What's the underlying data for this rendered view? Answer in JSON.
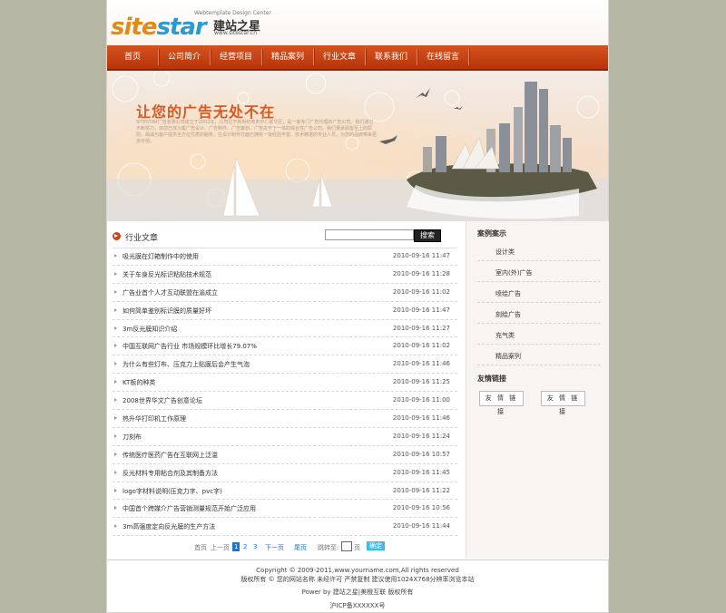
{
  "logo": {
    "tagline": "Webtemplate Design Center",
    "word_a": "site",
    "word_b": "star",
    "cn": "建站之星",
    "url": "www.sitestar.cn"
  },
  "nav": [
    "首页",
    "公司简介",
    "经营项目",
    "精品案列",
    "行业文章",
    "联系我们",
    "在线留言"
  ],
  "banner": {
    "title": "让您的广告无处不在",
    "text": "SITESTAR广告有限公司成立于2002年，公司位于新世纪商务中心繁华区，是一家专门广告代理的广告公司。我们通过不断努力，目前已成为集广告设计、广告制作、广告策划、广告发布于一体的综合性广告公司。我们秉承顾客至上的原则，竭诚为客户提供全方位优质的服务，在设计制作方面已拥有一批经验丰富、技术精湛的专业人员，为您的品牌带来更多价值。"
  },
  "section": {
    "title": "行业文章",
    "search_placeholder": "",
    "search_button": "搜索"
  },
  "news": [
    {
      "title": "吸光膜在灯箱制作中的使用",
      "date": "2010-09-16 11:47"
    },
    {
      "title": "关于车身反光标识粘贴技术规范",
      "date": "2010-09-16 11:28"
    },
    {
      "title": "广告业首个人才互动联盟在渝成立",
      "date": "2010-09-16 11:02"
    },
    {
      "title": "如何简单鉴别标识膜的质量好坏",
      "date": "2010-09-16 11:47"
    },
    {
      "title": "3m反光膜知识介绍",
      "date": "2010-09-16 11:27"
    },
    {
      "title": "中国互联网广告行业 市场规模环比增长79.07%",
      "date": "2010-09-16 11:02"
    },
    {
      "title": "为什么有些灯布、压克力上贴膜后会产生气泡",
      "date": "2010-09-16 11:46"
    },
    {
      "title": "KT板的种类",
      "date": "2010-09-16 11:25"
    },
    {
      "title": "2008世界华文广告创意论坛",
      "date": "2010-09-16 11:00"
    },
    {
      "title": "热升华打印机工作原理",
      "date": "2010-09-16 11:46"
    },
    {
      "title": "刀刻布",
      "date": "2010-09-16 11:24"
    },
    {
      "title": "传统医疗医药广告在互联网上泛滥",
      "date": "2010-09-16 10:57"
    },
    {
      "title": "反光材料专用粘合剂及其制备方法",
      "date": "2010-09-16 11:45"
    },
    {
      "title": "logo字材料说明(压克力字、pvc字)",
      "date": "2010-09-16 11:22"
    },
    {
      "title": "中国首个跨媒介广告营销测量规范开始广泛应用",
      "date": "2010-09-16 10:56"
    },
    {
      "title": "3m高强度定向反光膜的生产方法",
      "date": "2010-09-16 11:44"
    }
  ],
  "pager": {
    "first": "首页",
    "prev": "上一页",
    "pages": [
      "1",
      "2",
      "3"
    ],
    "current": "1",
    "next": "下一页",
    "last": "尾页",
    "jump_label": "跳转至:",
    "page_unit": "页",
    "go": "确定"
  },
  "side": {
    "case_title": "案例案示",
    "cases": [
      "设计类",
      "室内(外)广告",
      "喷绘广告",
      "刻绘广告",
      "充气类",
      "精品案列"
    ],
    "links_title": "友情链接",
    "links": [
      "友 情 链 接",
      "友 情 链 接"
    ]
  },
  "footer": {
    "copyright": "Copyright © 2009-2011,www.yourname.com,All rights reserved",
    "notice": "版权所有 © 您的网站名称 未经许可 严禁复制 建议使用1024X768分辨率浏览本站",
    "power": "Power by 建站之星|美橙互联 版权所有",
    "icp": "沪ICP备XXXXXX号"
  },
  "colors": {
    "nav": "#c4421a",
    "accent": "#d45a26",
    "page_bg": "#b6b6a4",
    "link_blue": "#2075c9"
  }
}
